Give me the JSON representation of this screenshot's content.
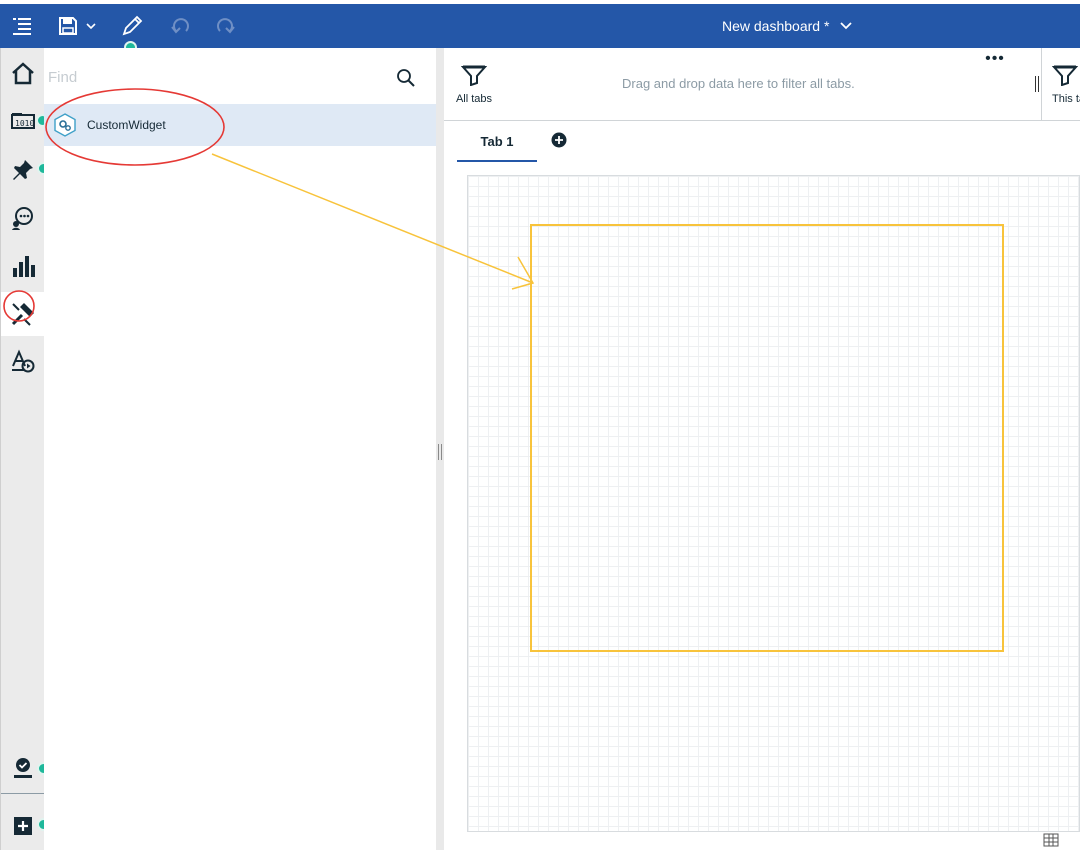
{
  "topbar": {
    "title": "New dashboard *",
    "background_color": "#2457a8",
    "buttons": [
      {
        "name": "menu",
        "icon": "menu-list-icon"
      },
      {
        "name": "save",
        "icon": "save-icon"
      },
      {
        "name": "edit",
        "icon": "pencil-icon"
      },
      {
        "name": "undo",
        "icon": "undo-icon"
      },
      {
        "name": "redo",
        "icon": "redo-icon"
      }
    ]
  },
  "rail": {
    "items": [
      {
        "name": "home",
        "icon": "home-icon"
      },
      {
        "name": "data",
        "icon": "data-sources-icon"
      },
      {
        "name": "pins",
        "icon": "pin-icon"
      },
      {
        "name": "assistant",
        "icon": "assistant-chat-icon"
      },
      {
        "name": "visualizations",
        "icon": "bar-chart-icon"
      },
      {
        "name": "custom-widgets",
        "icon": "widget-tools-icon",
        "active": true
      },
      {
        "name": "text-media",
        "icon": "text-media-icon"
      },
      {
        "name": "profile",
        "icon": "user-check-icon"
      },
      {
        "name": "add",
        "icon": "add-box-icon"
      }
    ]
  },
  "panel": {
    "search_placeholder": "Find",
    "items": [
      {
        "label": "CustomWidget",
        "icon": "custom-widget-icon"
      }
    ]
  },
  "filterbar": {
    "all_tabs_label": "All tabs",
    "drop_hint": "Drag and drop data here to filter all tabs.",
    "more_label": "•••",
    "this_tab_label": "This tab"
  },
  "tabs": [
    {
      "label": "Tab 1",
      "active": true
    }
  ],
  "colors": {
    "accent": "#2457a8",
    "annotation_circle": "#e53935",
    "arrow": "#f8c33b",
    "marker": "#1fb89b"
  }
}
